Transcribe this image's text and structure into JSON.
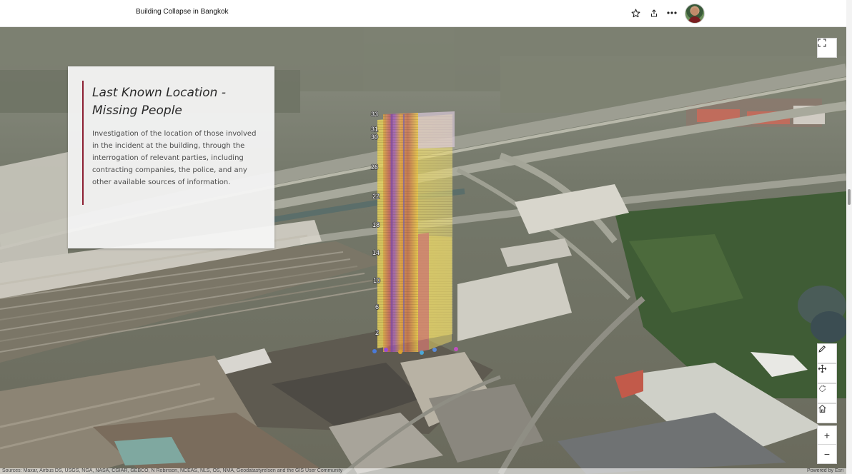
{
  "header": {
    "title": "Building Collapse in Bangkok",
    "favorite_icon": "star-icon",
    "share_icon": "share-icon",
    "more_icon": "more-horizontal-icon"
  },
  "panel": {
    "heading": "Last Known Location - Missing People",
    "body": "Investigation of the location of those involved in the incident at the building, through the interrogation of relevant parties, including contracting companies, the police, and any other available sources of information."
  },
  "floor_labels": [
    "33",
    "31",
    "30",
    "26",
    "22",
    "18",
    "14",
    "10",
    "6",
    "2"
  ],
  "map_tools": {
    "fullscreen_icon": "expand-icon",
    "tools": [
      {
        "name": "measure-tool",
        "icon": "pencil-icon"
      },
      {
        "name": "pan-tool",
        "icon": "move-icon"
      },
      {
        "name": "rotate-tool",
        "icon": "rotate-icon"
      },
      {
        "name": "home-tool",
        "icon": "home-icon"
      }
    ],
    "zoom_in": "+",
    "zoom_out": "−"
  },
  "attribution": {
    "sources": "Sources: Maxar, Airbus DS, USGS, NGA, NASA, CGIAR, GEBCO, N Robinson, NCEAS, NLS, OS, NMA, Geodatastyrelsen and the GIS User Community",
    "powered_by": "Powered by Esri"
  },
  "colors": {
    "accent": "#8c1f32",
    "building_yellow": "#e8cf4a",
    "building_purple": "#a05ab8"
  }
}
